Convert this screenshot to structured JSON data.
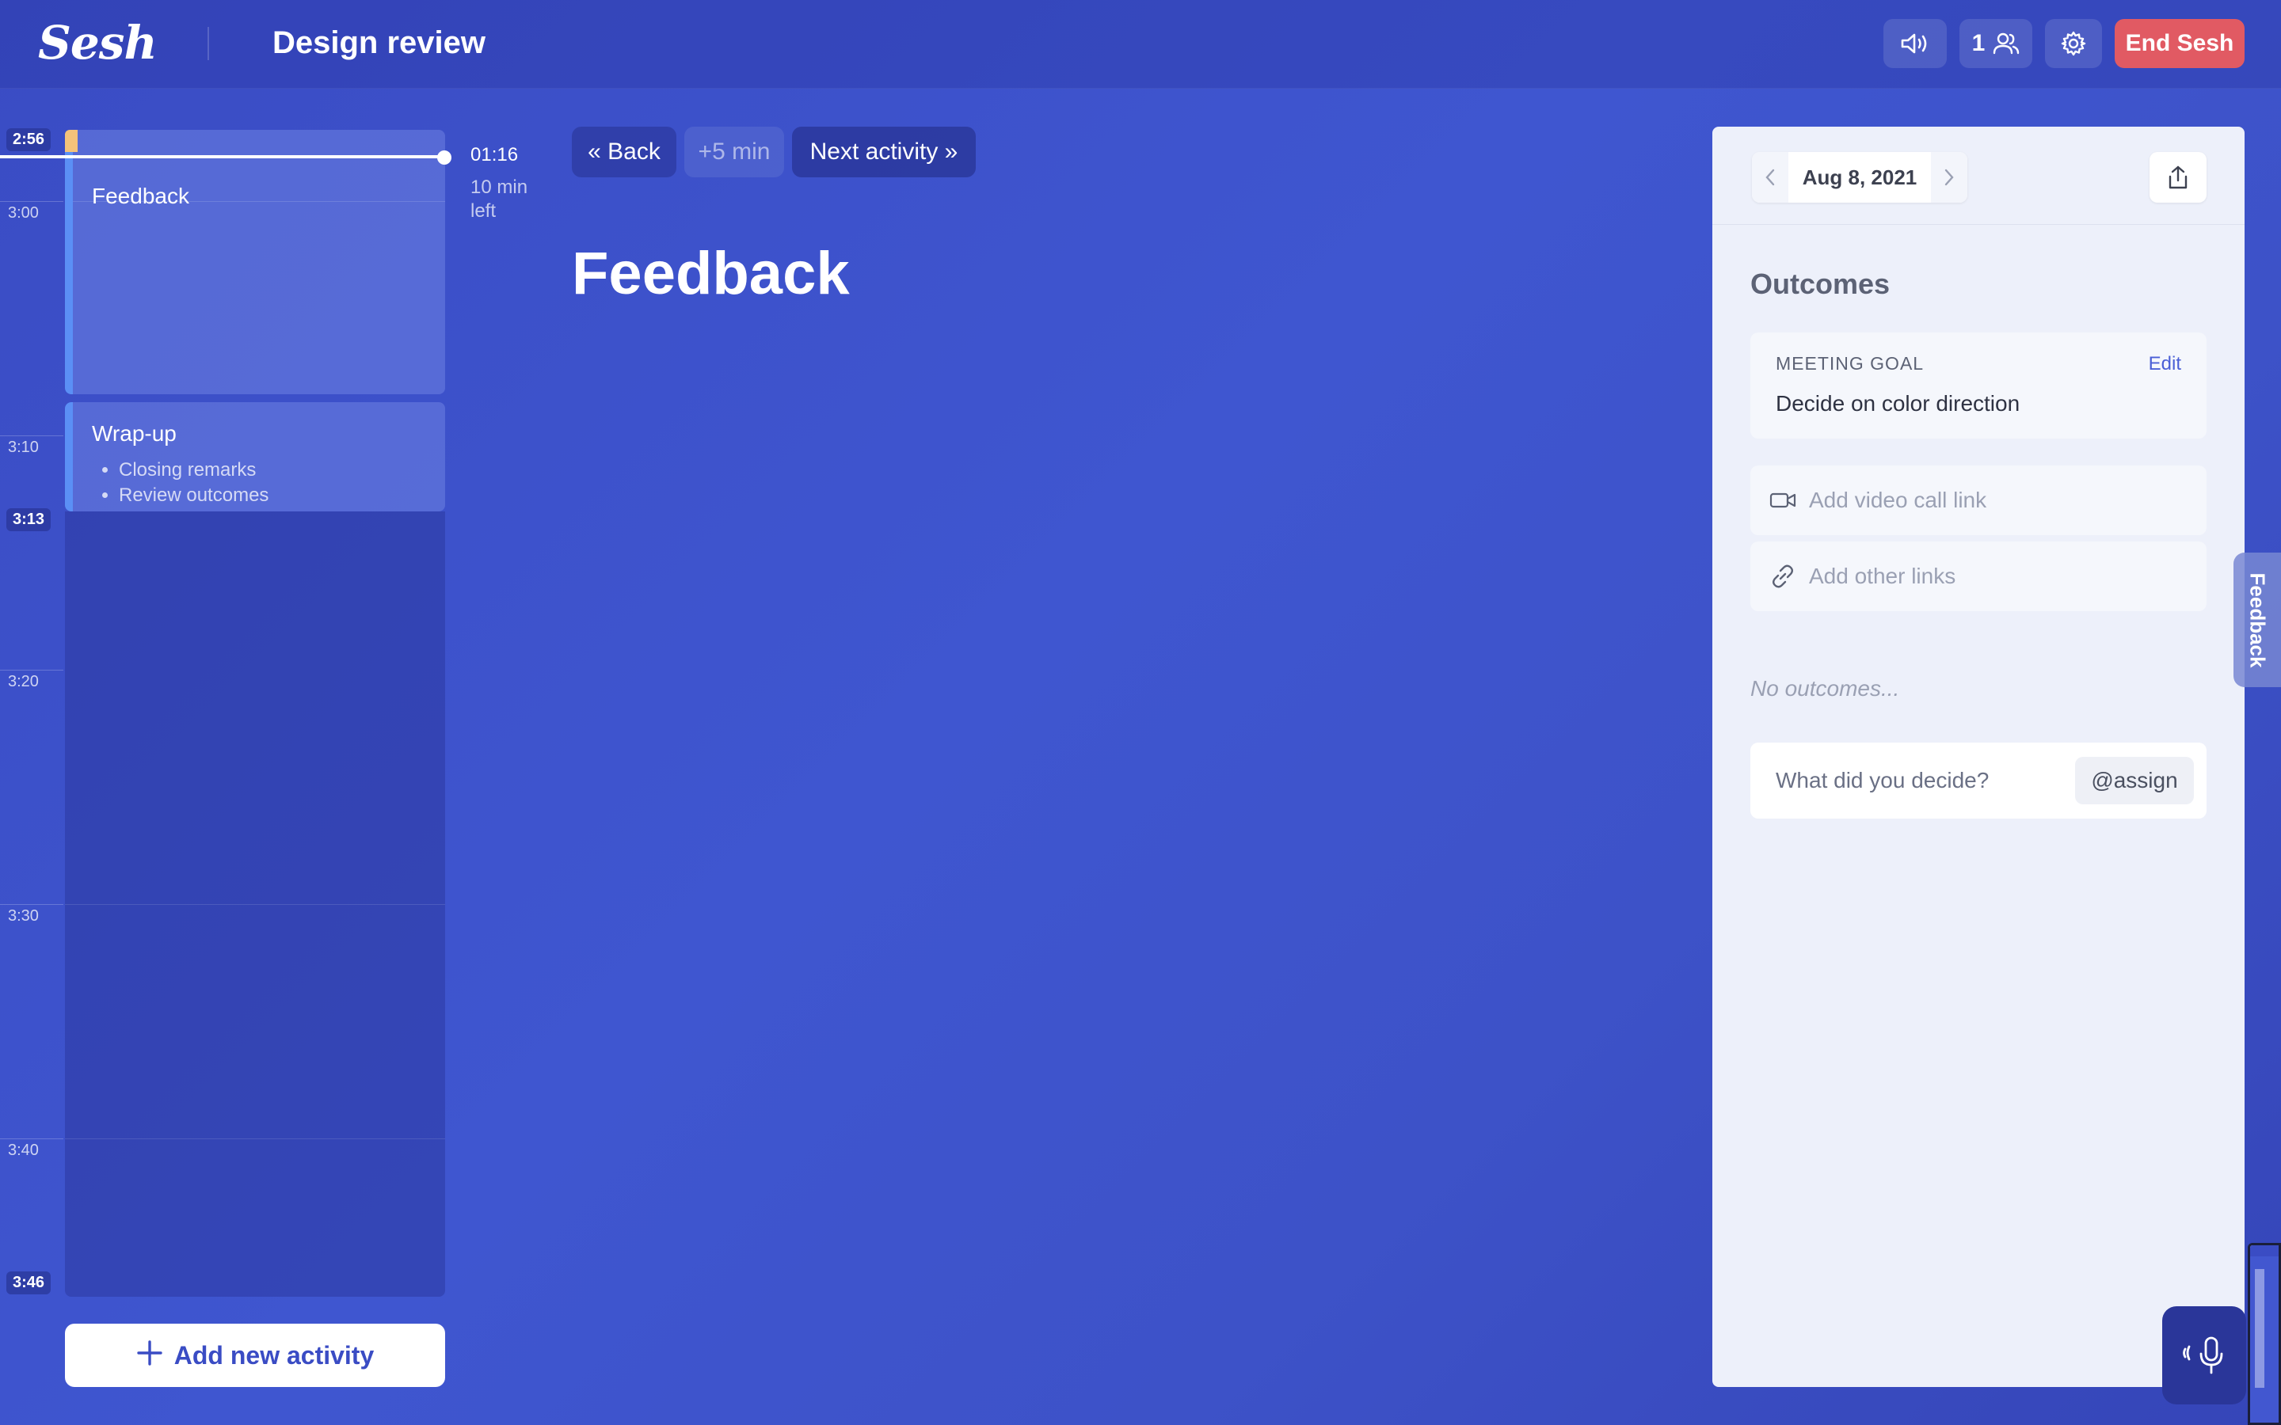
{
  "app": {
    "logo": "Sesh",
    "meeting_title": "Design review"
  },
  "toolbar": {
    "sound_icon": "speaker-icon",
    "participant_count": "1",
    "people_icon": "people-icon",
    "settings_icon": "gear-icon",
    "end_label": "End Sesh"
  },
  "timeline": {
    "start_time": "2:56",
    "end_time": "3:46",
    "current_marker_time": "3:13",
    "ticks": [
      "3:00",
      "3:10",
      "3:20",
      "3:30",
      "3:40"
    ],
    "elapsed": "01:16",
    "remaining": "10 min left",
    "activities": [
      {
        "title": "Feedback",
        "bullets": []
      },
      {
        "title": "Wrap-up",
        "bullets": [
          "Closing remarks",
          "Review outcomes"
        ]
      }
    ],
    "add_activity_label": "Add new activity"
  },
  "controls": {
    "back_label": "« Back",
    "plus_label": "+5 min",
    "next_label": "Next activity »"
  },
  "current_activity": {
    "title": "Feedback"
  },
  "panel": {
    "date": "Aug 8, 2021",
    "outcomes_title": "Outcomes",
    "goal_label": "MEETING GOAL",
    "goal_edit": "Edit",
    "goal_text": "Decide on color direction",
    "video_link_placeholder": "Add video call link",
    "other_links_placeholder": "Add other links",
    "no_outcomes": "No outcomes...",
    "decide_placeholder": "What did you decide?",
    "assign_label": "@assign"
  },
  "feedback_tab": "Feedback",
  "colors": {
    "accent": "#3a4cc4",
    "end_button": "#e15a63",
    "activity_bar": "#5b8ff5",
    "overtime": "#f4c27a"
  }
}
